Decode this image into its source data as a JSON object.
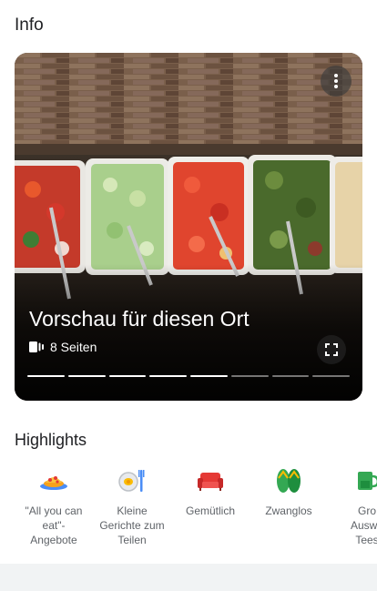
{
  "info": {
    "title": "Info"
  },
  "preview": {
    "title": "Vorschau für diesen Ort",
    "pages_label": "8 Seiten",
    "progress": {
      "total": 8,
      "completed": 5
    },
    "image_description": "photo"
  },
  "highlights": {
    "title": "Highlights",
    "items": [
      {
        "label": "\"All you can\neat\"-\nAngebote",
        "icon": "pizza-plate-icon"
      },
      {
        "label": "Kleine\nGerichte zum\nTeilen",
        "icon": "small-plates-icon"
      },
      {
        "label": "Gemütlich",
        "icon": "sofa-icon"
      },
      {
        "label": "Zwanglos",
        "icon": "flip-flops-icon"
      },
      {
        "label": "Gro\nAuswa\nTees",
        "icon": "tea-icon"
      }
    ]
  },
  "colors": {
    "title_text": "#202124",
    "label_text": "#5f6368",
    "bottom_band": "#f1f3f4"
  }
}
